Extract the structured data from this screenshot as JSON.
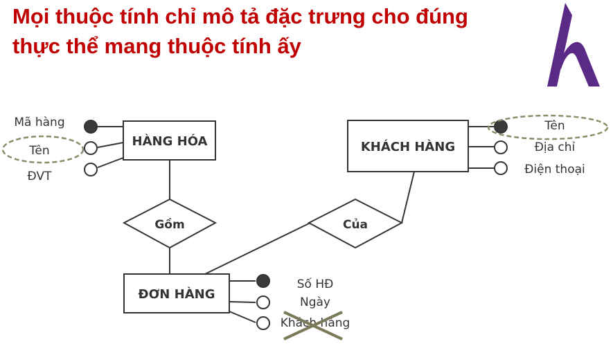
{
  "title": {
    "line1": "Mọi thuộc tính chỉ mô tả đặc trưng cho đúng",
    "line2": "thực thể mang thuộc tính ấy"
  },
  "logo": {
    "icon": "h-logo",
    "color": "#5b2a86"
  },
  "colors": {
    "title": "#c00000",
    "line": "#333333",
    "highlight": "#8b8b6a",
    "cross": "#7a7a5a"
  },
  "entities": {
    "hang_hoa": "HÀNG HÓA",
    "khach_hang": "KHÁCH HÀNG",
    "don_hang": "ĐƠN HÀNG"
  },
  "relationships": {
    "gom": "Gồm",
    "cua": "Của"
  },
  "attributes": {
    "hang_hoa": [
      "Mã hàng",
      "Tên",
      "ĐVT"
    ],
    "khach_hang": [
      "Tên",
      "Địa chỉ",
      "Điện thoại"
    ],
    "don_hang": [
      "Số HĐ",
      "Ngày",
      "Khách hàng"
    ]
  }
}
